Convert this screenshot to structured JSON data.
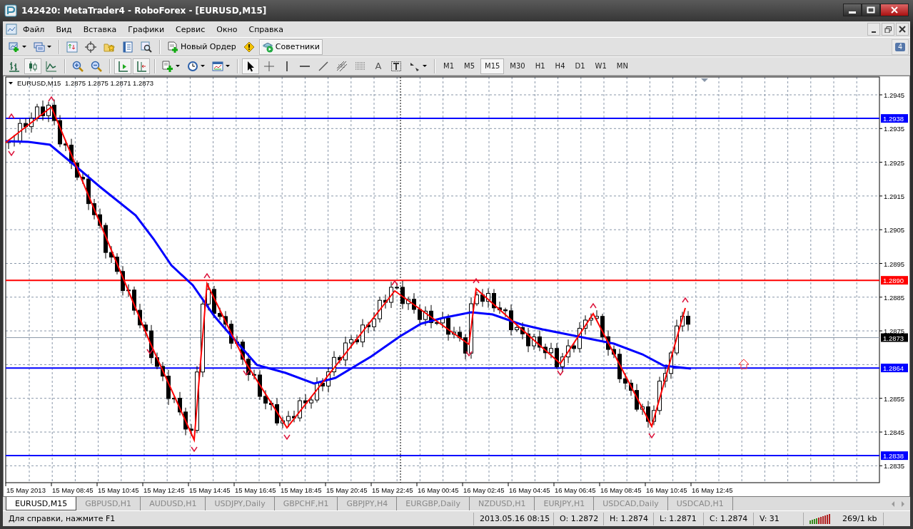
{
  "window": {
    "title": "142420: MetaTrader4 - RoboForex - [EURUSD,M15]"
  },
  "menu": [
    "Файл",
    "Вид",
    "Вставка",
    "Графики",
    "Сервис",
    "Окно",
    "Справка"
  ],
  "toolbar": {
    "new_order": "Новый Ордер",
    "experts": {
      "label": "Советники",
      "on": true
    }
  },
  "chart_type_buttons": [
    {
      "selected": false
    },
    {
      "selected": true
    },
    {
      "selected": false
    }
  ],
  "view_toggles": [
    {
      "on": true
    },
    {
      "on": true
    }
  ],
  "draw_tools": [
    {
      "selected": true
    },
    {
      "selected": false
    },
    {
      "selected": false
    },
    {
      "selected": false
    },
    {
      "selected": false
    },
    {
      "selected": false
    },
    {
      "selected": false
    },
    {
      "selected": false,
      "label": "A"
    },
    {
      "selected": false
    },
    {
      "selected": false
    }
  ],
  "timeframes": [
    {
      "label": "M1",
      "selected": false
    },
    {
      "label": "M5",
      "selected": false
    },
    {
      "label": "M15",
      "selected": true
    },
    {
      "label": "M30",
      "selected": false
    },
    {
      "label": "H1",
      "selected": false
    },
    {
      "label": "H4",
      "selected": false
    },
    {
      "label": "D1",
      "selected": false
    },
    {
      "label": "W1",
      "selected": false
    },
    {
      "label": "MN",
      "selected": false
    }
  ],
  "notifications": {
    "count": "4"
  },
  "chart": {
    "symbol": "EURUSD,M15",
    "quote": "1.2875 1.2875 1.2871 1.2873",
    "price_ticks": [
      "1.2945",
      "1.2935",
      "1.2925",
      "1.2915",
      "1.2905",
      "1.2895",
      "1.2885",
      "1.2875",
      "1.2855",
      "1.2845",
      "1.2835"
    ],
    "price_levels": [
      {
        "label": "1.2938",
        "kind": "line",
        "color": "#0000ff"
      },
      {
        "label": "1.2890",
        "kind": "line",
        "color": "#ff0000"
      },
      {
        "label": "1.2873",
        "kind": "bid",
        "color": "#000000"
      },
      {
        "label": "1.2864",
        "kind": "line",
        "color": "#0000ff"
      },
      {
        "label": "1.2838",
        "kind": "line",
        "color": "#0000ff"
      }
    ],
    "time_labels": [
      "15 May 2013",
      "15 May 08:45",
      "15 May 10:45",
      "15 May 12:45",
      "15 May 14:45",
      "15 May 16:45",
      "15 May 18:45",
      "15 May 20:45",
      "15 May 22:45",
      "16 May 00:45",
      "16 May 02:45",
      "16 May 04:45",
      "16 May 06:45",
      "16 May 08:45",
      "16 May 10:45",
      "16 May 12:45"
    ]
  },
  "tabs": [
    {
      "label": "EURUSD,M15",
      "selected": true
    },
    {
      "label": "GBPUSD,H1",
      "selected": false
    },
    {
      "label": "AUDUSD,H1",
      "selected": false
    },
    {
      "label": "USDJPY,Daily",
      "selected": false
    },
    {
      "label": "GBPCHF,H1",
      "selected": false
    },
    {
      "label": "GBPJPY,H4",
      "selected": false
    },
    {
      "label": "EURGBP,Daily",
      "selected": false
    },
    {
      "label": "NZDUSD,H1",
      "selected": false
    },
    {
      "label": "EURJPY,H1",
      "selected": false
    },
    {
      "label": "USDCAD,Daily",
      "selected": false
    },
    {
      "label": "USDCAD,H1",
      "selected": false
    }
  ],
  "status_bar": {
    "help": "Для справки, нажмите F1",
    "datetime": "2013.05.16 08:15",
    "open": "O: 1.2872",
    "high": "H: 1.2874",
    "low": "L: 1.2871",
    "close": "C: 1.2874",
    "volume": "V: 31",
    "traffic": "269/1 kb"
  }
}
